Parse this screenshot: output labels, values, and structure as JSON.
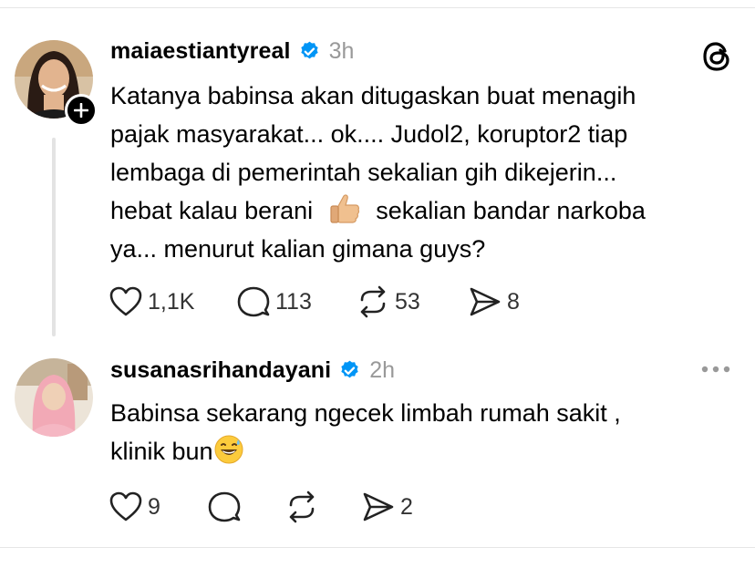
{
  "posts": [
    {
      "username": "maiaestiantyreal",
      "time": "3h",
      "text_lines": [
        "Katanya babinsa akan ditugaskan buat menagih",
        "pajak masyarakat... ok.... Judol2, koruptor2 tiap",
        "lembaga di pemerintah sekalian gih dikejerin...",
        "hebat kalau berani",
        "sekalian bandar narkoba",
        "ya... menurut kalian gimana guys?"
      ],
      "likes": "1,1K",
      "replies": "113",
      "reposts": "53",
      "shares": "8"
    },
    {
      "username": "susanasrihandayani",
      "time": "2h",
      "text_lines": [
        "Babinsa sekarang ngecek limbah rumah sakit ,",
        "klinik bun"
      ],
      "likes": "9",
      "replies": "",
      "reposts": "",
      "shares": "2"
    }
  ],
  "colors": {
    "verified": "#0095f6",
    "muted": "#999999",
    "divider": "#e6e6e6"
  },
  "icons": {
    "post1_emoji": "thumbs-up",
    "post2_emoji": "grinning-sweat",
    "app_logo": "threads-logo",
    "menu": "more-horizontal"
  }
}
